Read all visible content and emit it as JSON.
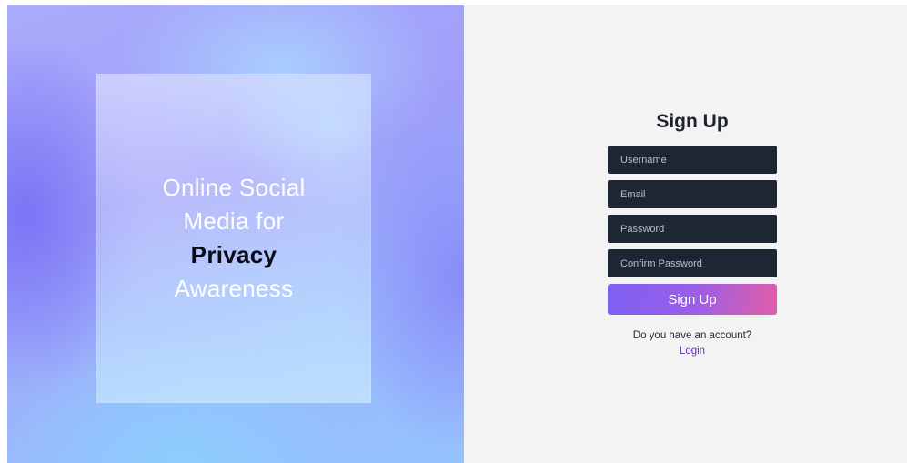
{
  "hero": {
    "line1": "Online Social",
    "line2": "Media for",
    "line3": "Privacy",
    "line4": "Awareness"
  },
  "signup": {
    "title": "Sign Up",
    "fields": {
      "username_placeholder": "Username",
      "email_placeholder": "Email",
      "password_placeholder": "Password",
      "confirm_password_placeholder": "Confirm Password"
    },
    "submit_label": "Sign Up",
    "account_prompt": "Do you have an account?",
    "login_link": "Login"
  },
  "colors": {
    "input_bg": "#1f2633",
    "button_gradient_start": "#7c61f3",
    "button_gradient_end": "#e25da8",
    "link": "#5b2fb6",
    "panel_bg": "#f3f3f3"
  }
}
